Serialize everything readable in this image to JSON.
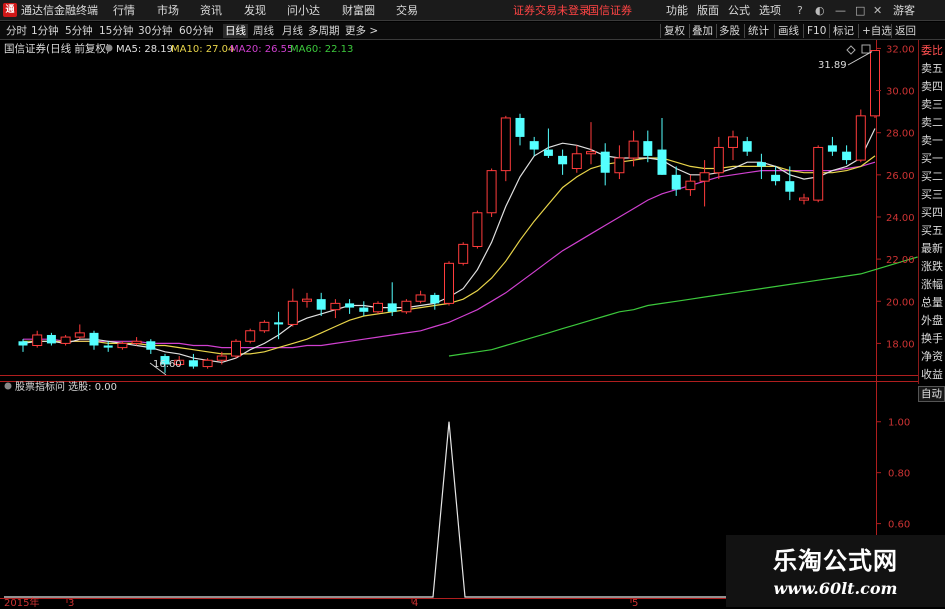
{
  "menubar": {
    "app_title": "通达信金融终端",
    "items": [
      "行情",
      "市场",
      "资讯",
      "发现",
      "问小达",
      "财富圈",
      "交易"
    ],
    "notice": "证券交易未登录",
    "broker": "国信证券",
    "right_items": [
      "功能",
      "版面",
      "公式",
      "选项"
    ],
    "guest": "游客"
  },
  "toolbar": {
    "periods": [
      "分时",
      "1分钟",
      "5分钟",
      "15分钟",
      "30分钟",
      "60分钟",
      "日线",
      "周线",
      "月线",
      "多周期",
      "更多 >"
    ],
    "active_period": "日线",
    "right_buttons": [
      "复权",
      "叠加",
      "多股",
      "统计",
      "画线",
      "F10",
      "标记",
      "+自选",
      "返回"
    ]
  },
  "main_chart": {
    "stock_title": "国信证券(日线 前复权)",
    "ma_labels": [
      {
        "label": "MA5: 28.19",
        "color": "#e0e0e0"
      },
      {
        "label": "MA10: 27.04",
        "color": "#e8d44a"
      },
      {
        "label": "MA20: 26.55",
        "color": "#d040d0"
      },
      {
        "label": "MA60: 22.13",
        "color": "#3cc83c"
      }
    ],
    "price_ticks": [
      "32.00",
      "30.00",
      "28.00",
      "26.00",
      "24.00",
      "22.00",
      "20.00",
      "18.00"
    ],
    "high_marker": "31.89",
    "low_marker": "16.60",
    "colors": {
      "up": "#ff3c3c",
      "down": "#54ffff",
      "ma5": "#e0e0e0",
      "ma10": "#e8d44a",
      "ma20": "#d040d0",
      "ma60": "#3cc83c",
      "frame": "#b01e1e"
    }
  },
  "indicator_panel": {
    "title": "股票指标问 选股: 0.00",
    "ticks": [
      "1.00",
      "0.80",
      "0.60",
      "0.40"
    ],
    "current_value": "0.48",
    "signal_value": 1.0
  },
  "side_panel": {
    "top_label": "委比",
    "items": [
      "委比",
      "卖五",
      "卖四",
      "卖三",
      "卖二",
      "卖一",
      "买一",
      "买二",
      "买三",
      "买四",
      "买五",
      "最新",
      "涨跌",
      "涨幅",
      "总量",
      "外盘",
      "换手",
      "净资",
      "收益"
    ],
    "auto_button": "自动"
  },
  "date_axis": {
    "labels": [
      "2015年",
      "3",
      "4",
      "5"
    ]
  },
  "watermark": {
    "line1": "乐淘公式网",
    "line2": "www.60lt.com"
  },
  "chart_data": {
    "type": "candlestick",
    "y_range": [
      16.5,
      32.4
    ],
    "candles": [
      [
        18.1,
        18.2,
        17.6,
        17.9
      ],
      [
        17.9,
        18.6,
        17.8,
        18.4
      ],
      [
        18.4,
        18.5,
        17.9,
        18.0
      ],
      [
        18.0,
        18.4,
        17.9,
        18.3
      ],
      [
        18.3,
        18.9,
        18.2,
        18.5
      ],
      [
        18.5,
        18.6,
        17.7,
        17.9
      ],
      [
        17.9,
        18.1,
        17.6,
        17.8
      ],
      [
        17.8,
        18.1,
        17.7,
        18.0
      ],
      [
        18.0,
        18.3,
        17.9,
        18.1
      ],
      [
        18.1,
        18.2,
        17.5,
        17.7
      ],
      [
        17.4,
        17.5,
        16.6,
        17.0
      ],
      [
        17.0,
        17.4,
        16.9,
        17.2
      ],
      [
        17.2,
        17.5,
        16.8,
        16.9
      ],
      [
        16.9,
        17.3,
        16.8,
        17.2
      ],
      [
        17.2,
        17.6,
        17.0,
        17.4
      ],
      [
        17.4,
        18.2,
        17.3,
        18.1
      ],
      [
        18.1,
        18.7,
        18.0,
        18.6
      ],
      [
        18.6,
        19.1,
        18.5,
        19.0
      ],
      [
        19.0,
        19.5,
        18.2,
        18.9
      ],
      [
        18.9,
        20.6,
        18.8,
        20.0
      ],
      [
        20.0,
        20.4,
        19.7,
        20.1
      ],
      [
        20.1,
        20.4,
        19.3,
        19.6
      ],
      [
        19.6,
        20.1,
        19.2,
        19.9
      ],
      [
        19.9,
        20.1,
        19.4,
        19.7
      ],
      [
        19.7,
        20.0,
        19.3,
        19.5
      ],
      [
        19.5,
        20.0,
        19.4,
        19.9
      ],
      [
        19.9,
        20.9,
        19.3,
        19.5
      ],
      [
        19.5,
        20.1,
        19.4,
        20.0
      ],
      [
        20.0,
        20.5,
        19.9,
        20.3
      ],
      [
        20.3,
        20.4,
        19.6,
        19.9
      ],
      [
        19.9,
        21.9,
        19.8,
        21.8
      ],
      [
        21.8,
        22.8,
        21.7,
        22.7
      ],
      [
        22.6,
        24.3,
        22.5,
        24.2
      ],
      [
        24.2,
        26.3,
        24.0,
        26.2
      ],
      [
        26.2,
        28.8,
        25.7,
        28.7
      ],
      [
        28.7,
        28.9,
        27.4,
        27.8
      ],
      [
        27.6,
        27.8,
        26.9,
        27.2
      ],
      [
        27.2,
        28.2,
        26.8,
        26.9
      ],
      [
        26.9,
        27.2,
        26.0,
        26.5
      ],
      [
        26.3,
        27.4,
        26.1,
        27.0
      ],
      [
        27.0,
        28.5,
        26.5,
        27.1
      ],
      [
        27.1,
        27.5,
        25.5,
        26.1
      ],
      [
        26.1,
        27.4,
        25.8,
        26.8
      ],
      [
        26.8,
        28.1,
        26.4,
        27.6
      ],
      [
        27.6,
        28.1,
        26.6,
        26.9
      ],
      [
        27.2,
        28.7,
        26.0,
        26.0
      ],
      [
        26.0,
        26.4,
        25.0,
        25.3
      ],
      [
        25.3,
        26.0,
        25.0,
        25.7
      ],
      [
        25.7,
        26.7,
        24.5,
        26.1
      ],
      [
        26.1,
        27.8,
        25.8,
        27.3
      ],
      [
        27.3,
        28.1,
        26.7,
        27.8
      ],
      [
        27.6,
        27.8,
        26.9,
        27.1
      ],
      [
        26.6,
        27.0,
        25.8,
        26.4
      ],
      [
        26.0,
        26.4,
        25.5,
        25.7
      ],
      [
        25.7,
        26.4,
        24.8,
        25.2
      ],
      [
        24.8,
        25.1,
        24.6,
        24.9
      ],
      [
        24.8,
        27.4,
        24.7,
        27.3
      ],
      [
        27.4,
        27.8,
        26.9,
        27.1
      ],
      [
        27.1,
        27.4,
        26.5,
        26.7
      ],
      [
        26.7,
        29.1,
        26.6,
        28.8
      ],
      [
        28.8,
        31.9,
        28.7,
        31.9
      ]
    ],
    "ma5": [
      18.0,
      18.1,
      18.1,
      18.0,
      18.2,
      18.2,
      18.1,
      18.0,
      17.9,
      17.8,
      17.6,
      17.5,
      17.3,
      17.2,
      17.1,
      17.3,
      17.7,
      18.0,
      18.4,
      18.9,
      19.2,
      19.4,
      19.6,
      19.8,
      19.8,
      19.7,
      19.7,
      19.7,
      19.8,
      19.9,
      20.2,
      20.6,
      21.5,
      22.8,
      24.5,
      25.9,
      26.9,
      27.3,
      27.5,
      27.4,
      27.2,
      26.9,
      26.8,
      26.8,
      26.8,
      26.7,
      26.3,
      26.0,
      26.0,
      26.1,
      26.3,
      26.6,
      26.6,
      26.4,
      26.0,
      25.8,
      25.9,
      26.2,
      26.4,
      26.8,
      28.2
    ],
    "ma10": [
      18.1,
      18.1,
      18.1,
      18.1,
      18.1,
      18.1,
      18.0,
      18.0,
      18.0,
      17.9,
      17.9,
      17.8,
      17.7,
      17.6,
      17.5,
      17.5,
      17.5,
      17.6,
      17.8,
      18.0,
      18.2,
      18.5,
      18.8,
      19.1,
      19.3,
      19.4,
      19.5,
      19.6,
      19.7,
      19.8,
      19.9,
      20.1,
      20.5,
      21.1,
      21.9,
      22.9,
      23.8,
      24.6,
      25.4,
      25.9,
      26.3,
      26.5,
      26.6,
      26.7,
      26.8,
      26.8,
      26.6,
      26.4,
      26.3,
      26.3,
      26.4,
      26.4,
      26.4,
      26.4,
      26.2,
      26.1,
      26.1,
      26.1,
      26.2,
      26.4,
      26.9
    ],
    "ma20": [
      18.2,
      18.2,
      18.2,
      18.1,
      18.1,
      18.1,
      18.1,
      18.1,
      18.1,
      18.0,
      18.0,
      18.0,
      17.9,
      17.9,
      17.8,
      17.8,
      17.8,
      17.8,
      17.8,
      17.8,
      17.9,
      17.9,
      18.0,
      18.1,
      18.2,
      18.3,
      18.4,
      18.5,
      18.6,
      18.8,
      19.0,
      19.3,
      19.6,
      20.0,
      20.4,
      20.9,
      21.4,
      21.9,
      22.4,
      22.8,
      23.2,
      23.6,
      24.0,
      24.4,
      24.8,
      25.1,
      25.3,
      25.5,
      25.7,
      25.9,
      26.0,
      26.1,
      26.2,
      26.2,
      26.2,
      26.2,
      26.2,
      26.2,
      26.3,
      26.4,
      26.6
    ],
    "ma60_start": 30,
    "ma60": [
      17.4,
      17.5,
      17.6,
      17.7,
      17.9,
      18.1,
      18.3,
      18.5,
      18.7,
      18.9,
      19.1,
      19.3,
      19.5,
      19.6,
      19.8,
      19.9,
      20.0,
      20.1,
      20.2,
      20.3,
      20.4,
      20.5,
      20.6,
      20.7,
      20.8,
      20.9,
      21.0,
      21.1,
      21.2,
      21.3,
      21.5,
      21.7,
      21.9,
      22.1
    ],
    "indicator_signal_index": 30
  }
}
